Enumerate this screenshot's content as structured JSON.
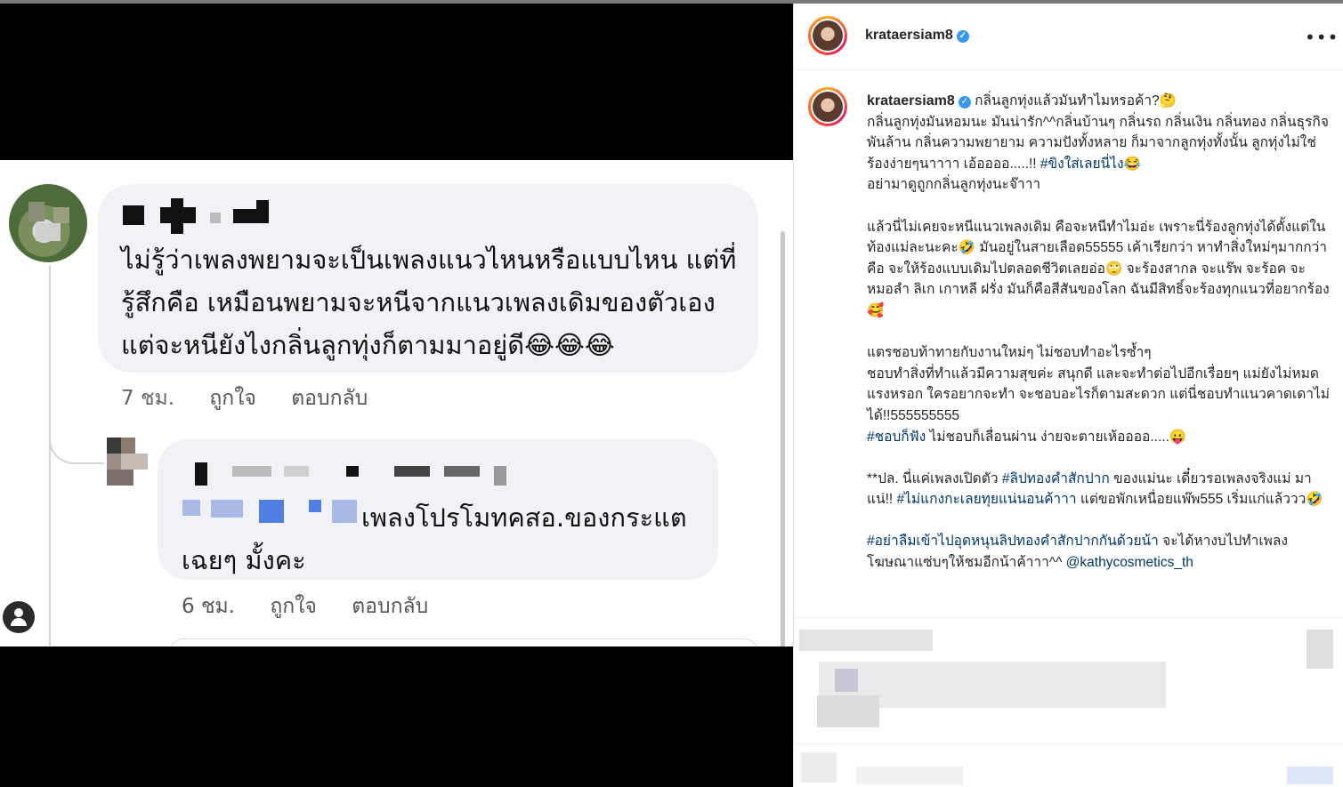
{
  "facebook": {
    "comment1": {
      "text": "ไม่รู้ว่าเพลงพยามจะเป็นเพลงแนวไหนหรือแบบไหน แต่ที่รู้สึกคือ เหมือนพยามจะหนีจากแนวเพลงเดิมของตัวเอง แต่จะหนียังไงกลิ่นลูกทุ่งก็ตามมาอยู่ดี😂😂😂",
      "time": "7 ชม.",
      "like": "ถูกใจ",
      "reply": "ตอบกลับ"
    },
    "comment2": {
      "text": "เพลงโปรโมทคสอ.ของกระแตเฉยๆ มั้งคะ",
      "time": "6 ชม.",
      "like": "ถูกใจ",
      "reply": "ตอบกลับ"
    }
  },
  "instagram": {
    "username": "krataersiam8",
    "more_icon": "•••",
    "verified_icon": "✓",
    "caption": {
      "title": "กลิ่นลูกทุ่งแล้วมันทำไมหรอค้า?🤔",
      "p1a": "กลิ่นลูกทุ่งมันหอมนะ มันน่ารัก^^กลิ่นบ้านๆ กลิ่นรถ กลิ่นเงิน กลิ่นทอง กลิ่นธุรกิจพันล้าน กลิ่นความพยายาม ความปังทั้งหลาย ก็มาจากลูกทุ่งทั้งนั้น ลูกทุ่งไม่ใช่ร้องง่ายๆนาาาา เอ้ออออ.....!! ",
      "p1tag": "#ขิงใส่เลยนี่ไง",
      "p1b": "😂",
      "p1c": "อย่ามาดูถูกกลิ่นลูกทุ่งนะจ๊าาา",
      "p2": "แล้วนี่ไม่เคยจะหนีแนวเพลงเดิม คือจะหนีทำไมอ่ะ เพราะนี่ร้องลูกทุ่งได้ตั้งแต่ในท้องแม่ละนะคะ🤣 มันอยู่ในสายเลือด55555 เค้าเรียกว่า หาทำสิ่งใหม่ๆมากกว่า",
      "p2b": "คือ จะให้ร้องแบบเดิมไปตลอดชีวิตเลยอ่อ🙄 จะร้องสากล จะแร๊พ จะร้อค จะหมอลำ ลิเก เกาหลี ฝรั่ง มันก็คือสีสันของโลก ฉันมีสิทธิ์จะร้องทุกแนวที่อยากร้อง🥰",
      "p3": "แตรชอบท้าทายกับงานใหม่ๆ ไม่ชอบทำอะไรซ้ำๆ",
      "p3b": "ชอบทำสิ่งที่ทำแล้วมีความสุขค่ะ สนุกดี และจะทำต่อไปอีกเรื่อยๆ แม่ยังไม่หมดแรงหรอก ใครอยากจะทำ จะชอบอะไรก็ตามสะดวก แต่นี่ชอบทำแนวคาดเดาไม่ได้!!555555555",
      "p3tag": "#ชอบก็ฟัง",
      "p3c": " ไม่ชอบก็เลื่อนผ่าน ง่ายจะตายเห้ออออ.....😛",
      "p4a": "**ปล. นี่แค่เพลงเปิดตัว ",
      "p4tag1": "#ลิปทองคำสักปาก",
      "p4b": " ของแม่นะ เดี๋ยวรอเพลงจริงแม่ มาแน่!! ",
      "p4tag2": "#ไม่แกงกะเลยทุยแน่นอนค้าาา",
      "p4c": " แต่ขอพักเหนื่อยแพ๊พ555 เริ่มแก่แล้ววว🤣",
      "p5tag": "#อย่าลืมเข้าไปอุดหนุนลิปทองคำสักปากกันด้วยน้า",
      "p5a": " จะได้หางบไปทำเพลงโฆษณาแซ่บๆให้ชมอีกน้าค้าาา^^ ",
      "p5mention": "@kathycosmetics_th"
    }
  }
}
